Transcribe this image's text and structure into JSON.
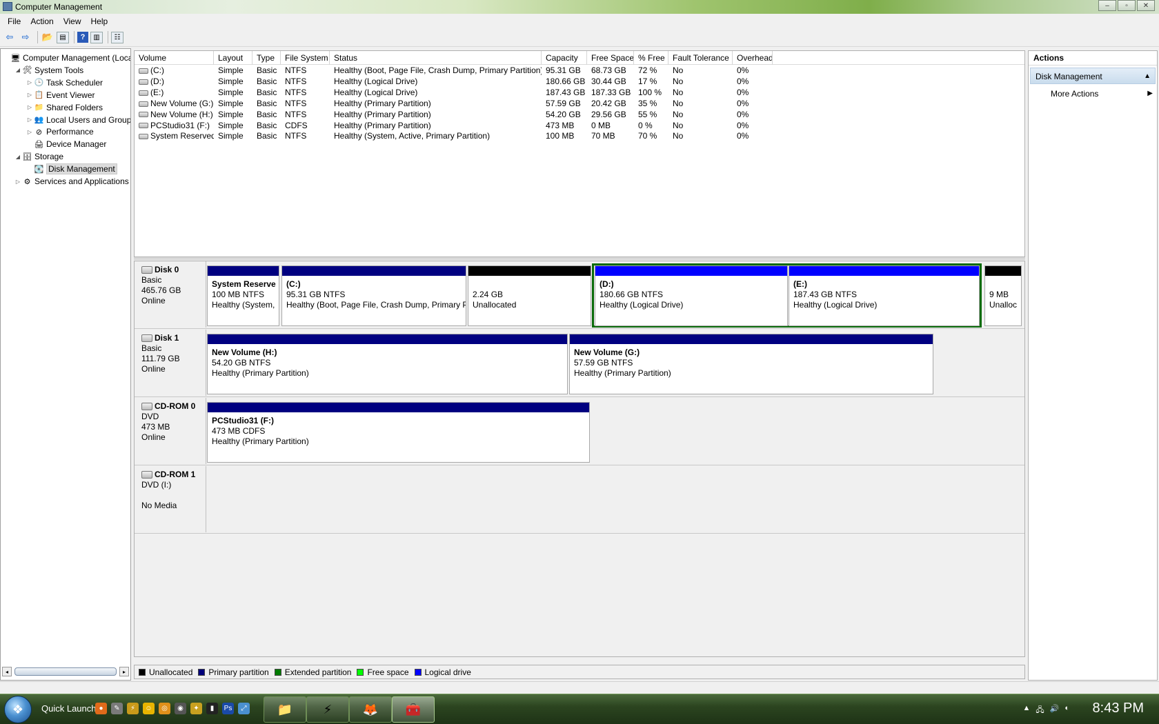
{
  "window": {
    "title": "Computer Management",
    "controls": [
      "–",
      "▫",
      "✕"
    ]
  },
  "menu": [
    "File",
    "Action",
    "View",
    "Help"
  ],
  "tree": [
    {
      "label": "Computer Management (Local",
      "exp": "",
      "icon": "🖥",
      "indent": 0,
      "name": "tree-root"
    },
    {
      "label": "System Tools",
      "exp": "◢",
      "icon": "🛠",
      "indent": 1,
      "name": "tree-system-tools"
    },
    {
      "label": "Task Scheduler",
      "exp": "▷",
      "icon": "🕒",
      "indent": 2,
      "name": "tree-task-scheduler"
    },
    {
      "label": "Event Viewer",
      "exp": "▷",
      "icon": "📋",
      "indent": 2,
      "name": "tree-event-viewer"
    },
    {
      "label": "Shared Folders",
      "exp": "▷",
      "icon": "📁",
      "indent": 2,
      "name": "tree-shared-folders"
    },
    {
      "label": "Local Users and Groups",
      "exp": "▷",
      "icon": "👥",
      "indent": 2,
      "name": "tree-local-users"
    },
    {
      "label": "Performance",
      "exp": "▷",
      "icon": "⊘",
      "indent": 2,
      "name": "tree-performance"
    },
    {
      "label": "Device Manager",
      "exp": "",
      "icon": "🖨",
      "indent": 2,
      "name": "tree-device-manager"
    },
    {
      "label": "Storage",
      "exp": "◢",
      "icon": "🗄",
      "indent": 1,
      "name": "tree-storage"
    },
    {
      "label": "Disk Management",
      "exp": "",
      "icon": "💽",
      "indent": 2,
      "name": "tree-disk-management",
      "selected": true
    },
    {
      "label": "Services and Applications",
      "exp": "▷",
      "icon": "⚙",
      "indent": 1,
      "name": "tree-services-apps"
    }
  ],
  "volumes": {
    "columns": [
      "Volume",
      "Layout",
      "Type",
      "File System",
      "Status",
      "Capacity",
      "Free Space",
      "% Free",
      "Fault Tolerance",
      "Overhead"
    ],
    "rows": [
      [
        "(C:)",
        "Simple",
        "Basic",
        "NTFS",
        "Healthy (Boot, Page File, Crash Dump, Primary Partition)",
        "95.31 GB",
        "68.73 GB",
        "72 %",
        "No",
        "0%"
      ],
      [
        "(D:)",
        "Simple",
        "Basic",
        "NTFS",
        "Healthy (Logical Drive)",
        "180.66 GB",
        "30.44 GB",
        "17 %",
        "No",
        "0%"
      ],
      [
        "(E:)",
        "Simple",
        "Basic",
        "NTFS",
        "Healthy (Logical Drive)",
        "187.43 GB",
        "187.33 GB",
        "100 %",
        "No",
        "0%"
      ],
      [
        "New Volume (G:)",
        "Simple",
        "Basic",
        "NTFS",
        "Healthy (Primary Partition)",
        "57.59 GB",
        "20.42 GB",
        "35 %",
        "No",
        "0%"
      ],
      [
        "New Volume (H:)",
        "Simple",
        "Basic",
        "NTFS",
        "Healthy (Primary Partition)",
        "54.20 GB",
        "29.56 GB",
        "55 %",
        "No",
        "0%"
      ],
      [
        "PCStudio31 (F:)",
        "Simple",
        "Basic",
        "CDFS",
        "Healthy (Primary Partition)",
        "473 MB",
        "0 MB",
        "0 %",
        "No",
        "0%"
      ],
      [
        "System Reserved",
        "Simple",
        "Basic",
        "NTFS",
        "Healthy (System, Active, Primary Partition)",
        "100 MB",
        "70 MB",
        "70 %",
        "No",
        "0%"
      ]
    ]
  },
  "disks": [
    {
      "name": "Disk 0",
      "line2": "Basic",
      "line3": "465.76 GB",
      "line4": "Online"
    },
    {
      "name": "Disk 1",
      "line2": "Basic",
      "line3": "111.79 GB",
      "line4": "Online"
    },
    {
      "name": "CD-ROM 0",
      "line2": "DVD",
      "line3": "473 MB",
      "line4": "Online"
    },
    {
      "name": "CD-ROM 1",
      "line2": "DVD (I:)",
      "line3": "",
      "line4": "No Media"
    }
  ],
  "partitions": {
    "disk0": [
      {
        "title": "System Reserve",
        "l2": "100 MB NTFS",
        "l3": "Healthy (System,",
        "kind": "primary"
      },
      {
        "title": "(C:)",
        "l2": "95.31 GB NTFS",
        "l3": "Healthy (Boot, Page File, Crash Dump, Primary P",
        "kind": "primary"
      },
      {
        "title": "",
        "l2": "2.24 GB",
        "l3": "Unallocated",
        "kind": "unallocated"
      },
      {
        "title": "(D:)",
        "l2": "180.66 GB NTFS",
        "l3": "Healthy (Logical Drive)",
        "kind": "logical"
      },
      {
        "title": "(E:)",
        "l2": "187.43 GB NTFS",
        "l3": "Healthy (Logical Drive)",
        "kind": "logical"
      },
      {
        "title": "",
        "l2": "9 MB",
        "l3": "Unalloc",
        "kind": "unallocated"
      }
    ],
    "disk1": [
      {
        "title": "New Volume  (H:)",
        "l2": "54.20 GB NTFS",
        "l3": "Healthy (Primary Partition)",
        "kind": "primary"
      },
      {
        "title": "New Volume  (G:)",
        "l2": "57.59 GB NTFS",
        "l3": "Healthy (Primary Partition)",
        "kind": "primary"
      }
    ],
    "cdrom0": [
      {
        "title": "PCStudio31  (F:)",
        "l2": "473 MB CDFS",
        "l3": "Healthy (Primary Partition)",
        "kind": "primary"
      }
    ]
  },
  "legend": [
    {
      "label": "Unallocated",
      "color": "#000000"
    },
    {
      "label": "Primary partition",
      "color": "#00007b"
    },
    {
      "label": "Extended partition",
      "color": "#007b00"
    },
    {
      "label": "Free space",
      "color": "#00ff00"
    },
    {
      "label": "Logical drive",
      "color": "#0000ff"
    }
  ],
  "colors": {
    "primary": "#000080",
    "logical": "#0000ff",
    "unallocated": "#000000",
    "extended": "#0a6b0a"
  },
  "actions": {
    "header": "Actions",
    "section": "Disk Management",
    "more": "More Actions"
  },
  "taskbar": {
    "quick_launch": "Quick Launch",
    "clock": "8:43 PM"
  }
}
